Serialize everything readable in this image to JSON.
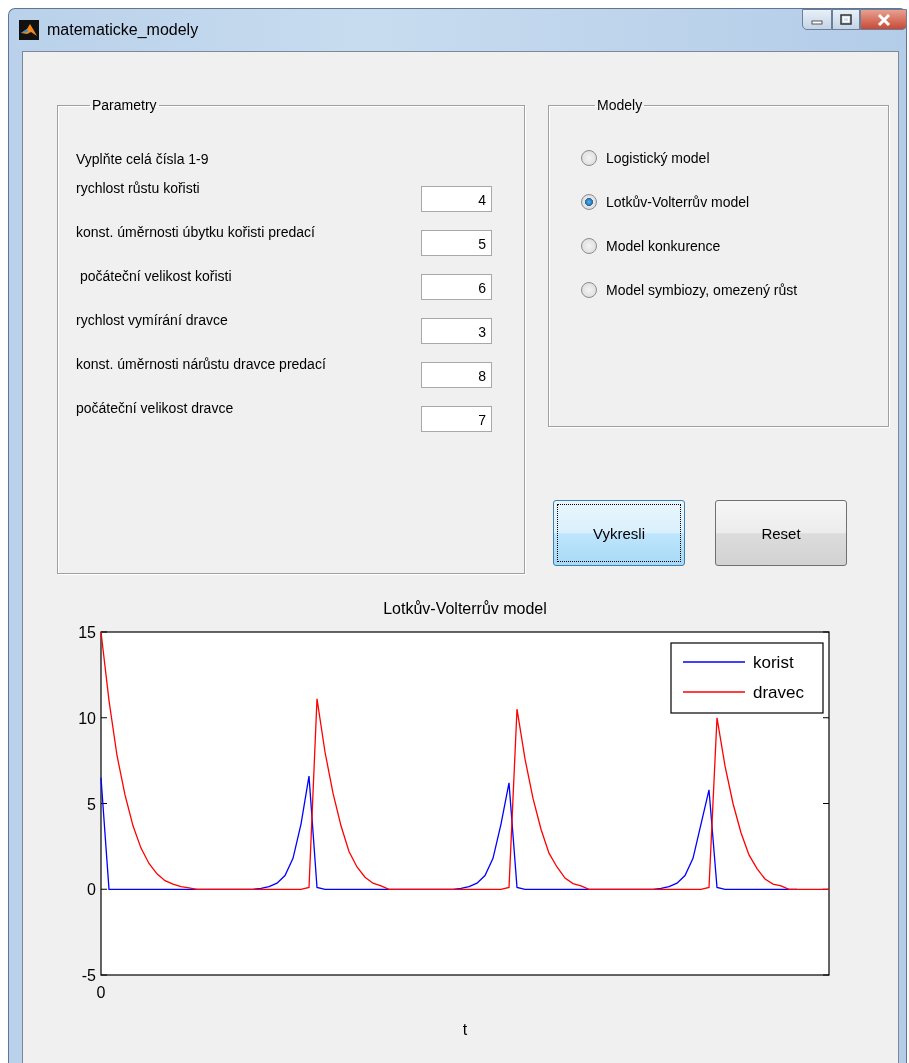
{
  "window": {
    "title": "matematicke_modely"
  },
  "parameters": {
    "title": "Parametry",
    "instruction": "Vyplňte celá čísla 1-9",
    "fields": [
      {
        "label": "rychlost růstu kořisti",
        "value": "4"
      },
      {
        "label": "konst. úměrnosti úbytku kořisti predací",
        "value": "5"
      },
      {
        "label": " počáteční velikost kořisti",
        "value": "6"
      },
      {
        "label": "rychlost vymírání dravce",
        "value": "3"
      },
      {
        "label": "konst. úměrnosti nárůstu dravce predací",
        "value": "8"
      },
      {
        "label": "počáteční velikost dravce",
        "value": "7"
      }
    ]
  },
  "models": {
    "title": "Modely",
    "options": [
      {
        "label": "Logistický model",
        "selected": false
      },
      {
        "label": "Lotkův-Volterrův model",
        "selected": true
      },
      {
        "label": "Model konkurence",
        "selected": false
      },
      {
        "label": "Model symbiozy, omezený růst",
        "selected": false
      }
    ]
  },
  "buttons": [
    {
      "label": "Vykresli",
      "focused": true
    },
    {
      "label": "Reset",
      "focused": false
    }
  ],
  "chart_data": {
    "type": "line",
    "title": "Lotkův-Volterrův model",
    "xlabel": "t",
    "ylim": [
      -5,
      15
    ],
    "yticks": [
      -5,
      0,
      5,
      10,
      15
    ],
    "legend": "upper right",
    "series": [
      {
        "name": "korist",
        "color": "#0000ff",
        "values": [
          6.5,
          0,
          0,
          0,
          0,
          0,
          0,
          0,
          0,
          0,
          0,
          0,
          0,
          0,
          0,
          0,
          0,
          0,
          0,
          0,
          0.05,
          0.15,
          0.35,
          0.8,
          1.8,
          3.8,
          6.6,
          0.1,
          0,
          0,
          0,
          0,
          0,
          0,
          0,
          0,
          0,
          0,
          0,
          0,
          0,
          0,
          0,
          0,
          0,
          0.05,
          0.15,
          0.35,
          0.8,
          1.8,
          3.8,
          6.2,
          0.1,
          0,
          0,
          0,
          0,
          0,
          0,
          0,
          0,
          0,
          0,
          0,
          0,
          0,
          0,
          0,
          0,
          0,
          0.05,
          0.15,
          0.35,
          0.8,
          1.8,
          3.8,
          5.8,
          0.1,
          0,
          0,
          0,
          0,
          0,
          0,
          0,
          0,
          0,
          0,
          null,
          null,
          null,
          null
        ]
      },
      {
        "name": "dravec",
        "color": "#ff0000",
        "values": [
          15,
          11,
          7.8,
          5.5,
          3.7,
          2.4,
          1.5,
          0.9,
          0.5,
          0.3,
          0.15,
          0.08,
          0,
          0,
          0,
          0,
          0,
          0,
          0,
          0,
          0,
          0,
          0,
          0,
          0,
          0,
          0.1,
          11.1,
          8,
          5.6,
          3.7,
          2.2,
          1.3,
          0.7,
          0.35,
          0.2,
          0,
          0,
          0,
          0,
          0,
          0,
          0,
          0,
          0,
          0,
          0,
          0,
          0,
          0,
          0,
          0.1,
          10.5,
          7.6,
          5.3,
          3.5,
          2.1,
          1.3,
          0.65,
          0.33,
          0.2,
          0,
          0,
          0,
          0,
          0,
          0,
          0,
          0,
          0,
          0,
          0,
          0,
          0,
          0,
          0,
          0.1,
          10,
          7.2,
          5,
          3.3,
          2,
          1.2,
          0.6,
          0.3,
          0.2,
          0,
          0,
          0,
          0,
          0,
          0
        ]
      }
    ]
  },
  "x_axis_origin_label": "0"
}
